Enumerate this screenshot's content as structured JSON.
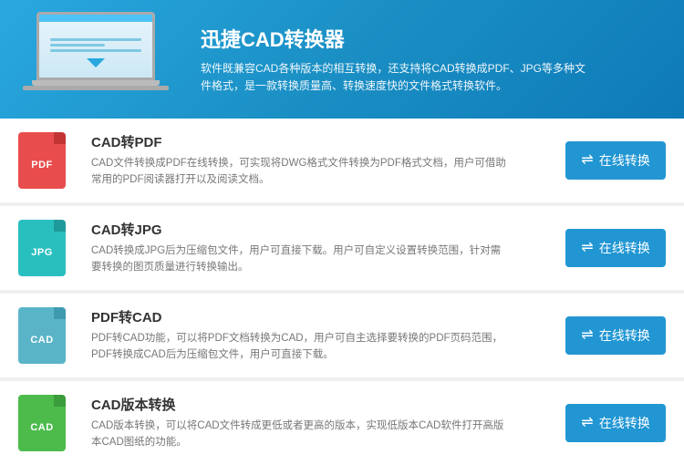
{
  "header": {
    "title": "迅捷CAD转换器",
    "description": "软件既兼容CAD各种版本的相互转换，还支持将CAD转换成PDF、JPG等多种文件格式，是一款转换质量高、转换速度快的文件格式转换软件。"
  },
  "items": [
    {
      "id": "cad-to-pdf",
      "icon_type": "pdf",
      "icon_label": "PDF",
      "title": "CAD转PDF",
      "description": "CAD文件转换成PDF在线转换，可实现将DWG格式文件转换为PDF格式文档，用户可借助常用的PDF阅读器打开以及阅读文档。",
      "button_label": "在线转换"
    },
    {
      "id": "cad-to-jpg",
      "icon_type": "jpg",
      "icon_label": "JPG",
      "title": "CAD转JPG",
      "description": "CAD转换成JPG后为压缩包文件，用户可直接下载。用户可自定义设置转换范围，针对需要转换的图页质量进行转换输出。",
      "button_label": "在线转换"
    },
    {
      "id": "pdf-to-cad",
      "icon_type": "cad",
      "icon_label": "CAD",
      "title": "PDF转CAD",
      "description": "PDF转CAD功能，可以将PDF文档转换为CAD，用户可自主选择要转换的PDF页码范围，PDF转换成CAD后为压缩包文件，用户可直接下载。",
      "button_label": "在线转换"
    },
    {
      "id": "cad-version",
      "icon_type": "cad-green",
      "icon_label": "CAD",
      "title": "CAD版本转换",
      "description": "CAD版本转换，可以将CAD文件转成更低或者更高的版本，实现低版本CAD软件打开高版本CAD图纸的功能。",
      "button_label": "在线转换"
    }
  ]
}
